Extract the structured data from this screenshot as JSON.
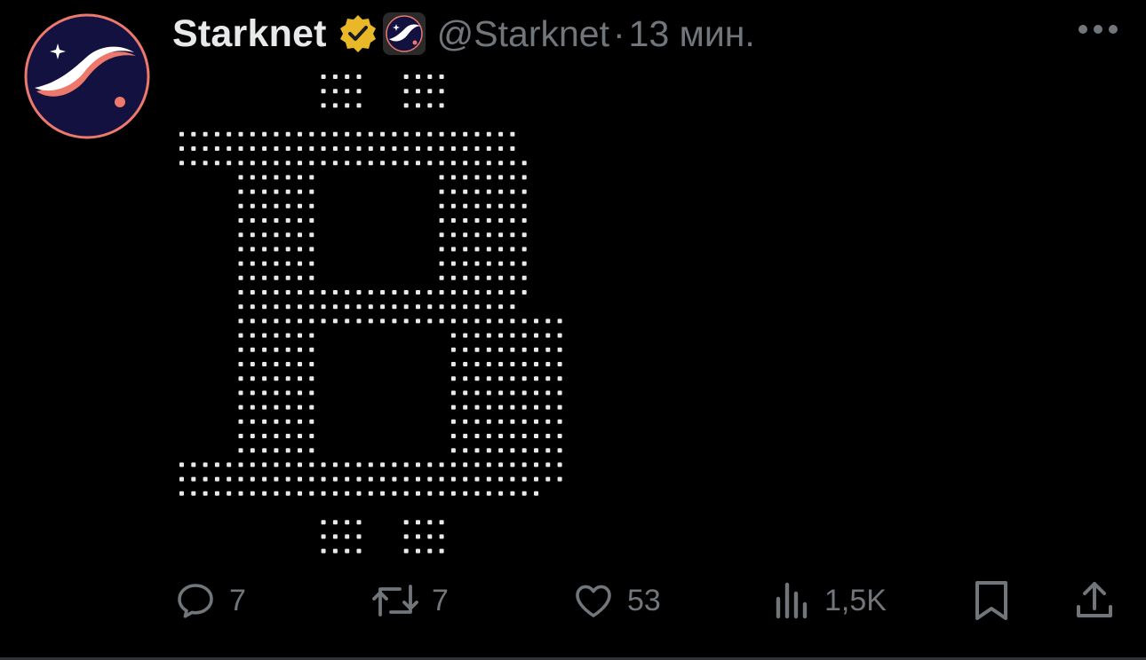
{
  "author": {
    "name": "Starknet",
    "handle": "@Starknet",
    "separator": "·",
    "time": "13 мин.",
    "avatar_icon": "starknet-logo-icon",
    "verified_icon": "gold-verified-badge-icon",
    "affiliate_icon": "starknet-affiliate-badge-icon"
  },
  "post": {
    "image": "bitcoin-symbol-braille-ascii-art"
  },
  "actions": {
    "reply": {
      "icon": "reply-icon",
      "count": "7"
    },
    "repost": {
      "icon": "repost-icon",
      "count": "7"
    },
    "like": {
      "icon": "heart-icon",
      "count": "53"
    },
    "views": {
      "icon": "views-chart-icon",
      "count": "1,5K"
    },
    "bookmark": {
      "icon": "bookmark-icon"
    },
    "share": {
      "icon": "share-icon"
    }
  },
  "colors": {
    "background": "#000000",
    "text": "#e7e9ea",
    "muted": "#71767b",
    "verified_gold": "#e8b828",
    "starknet_navy": "#12113f",
    "starknet_coral": "#ec796b"
  }
}
